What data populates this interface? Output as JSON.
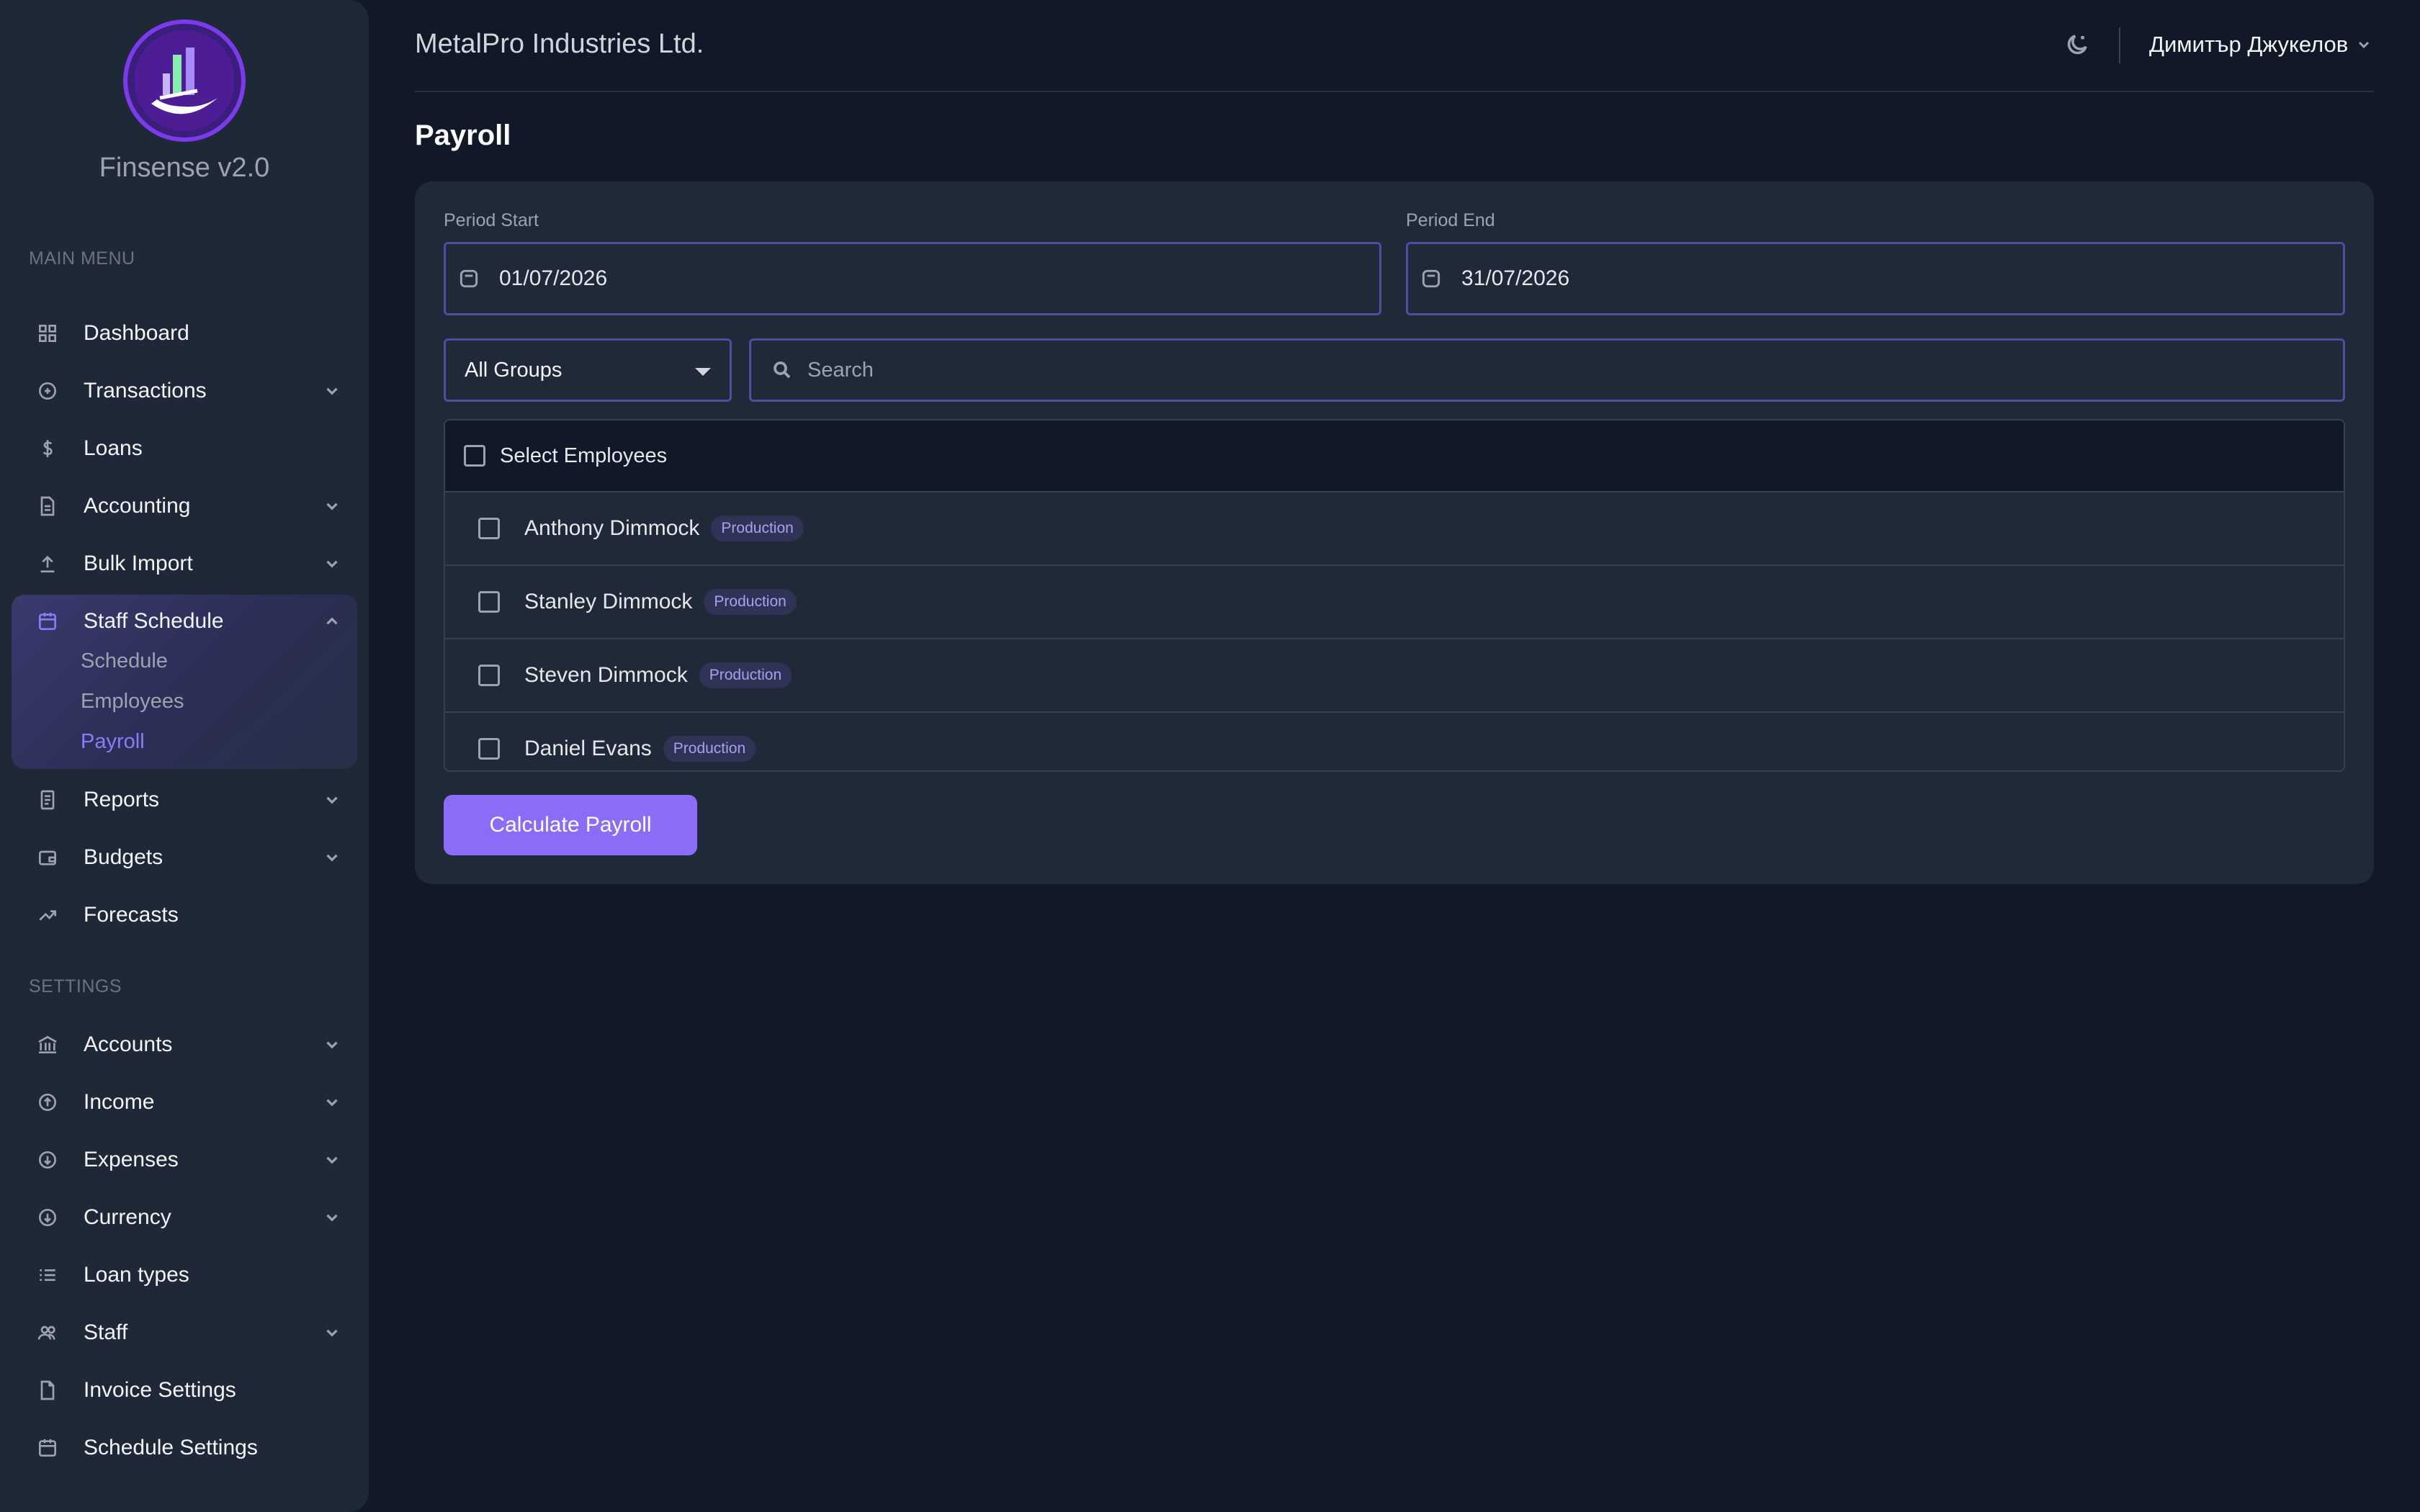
{
  "brand": {
    "name": "Finsense v2.0"
  },
  "sidebar": {
    "main_label": "MAIN MENU",
    "settings_label": "SETTINGS",
    "main_items": [
      {
        "label": "Dashboard",
        "icon": "grid-icon"
      },
      {
        "label": "Transactions",
        "icon": "plus-circle-icon"
      },
      {
        "label": "Loans",
        "icon": "dollar-icon"
      },
      {
        "label": "Accounting",
        "icon": "document-icon"
      },
      {
        "label": "Bulk Import",
        "icon": "upload-icon"
      },
      {
        "label": "Staff Schedule",
        "icon": "calendar-icon"
      },
      {
        "label": "Reports",
        "icon": "report-icon"
      },
      {
        "label": "Budgets",
        "icon": "wallet-icon"
      },
      {
        "label": "Forecasts",
        "icon": "trend-icon"
      }
    ],
    "staff_sub": [
      "Schedule",
      "Employees",
      "Payroll"
    ],
    "settings_items": [
      {
        "label": "Accounts",
        "icon": "bank-icon"
      },
      {
        "label": "Income",
        "icon": "arrow-up-circle-icon"
      },
      {
        "label": "Expenses",
        "icon": "arrow-down-circle-icon"
      },
      {
        "label": "Currency",
        "icon": "currency-icon"
      },
      {
        "label": "Loan types",
        "icon": "list-icon"
      },
      {
        "label": "Staff",
        "icon": "people-icon"
      },
      {
        "label": "Invoice Settings",
        "icon": "file-icon"
      },
      {
        "label": "Schedule Settings",
        "icon": "calendar-icon"
      }
    ]
  },
  "header": {
    "company": "MetalPro Industries Ltd.",
    "user": "Димитър Джукелов"
  },
  "page": {
    "title": "Payroll"
  },
  "form": {
    "period_start_label": "Period Start",
    "period_start_value": "01/07/2026",
    "period_end_label": "Period End",
    "period_end_value": "31/07/2026",
    "group_select": "All Groups",
    "search_placeholder": "Search",
    "select_all_label": "Select Employees",
    "employees": [
      {
        "name": "Anthony Dimmock",
        "group": "Production"
      },
      {
        "name": "Stanley Dimmock",
        "group": "Production"
      },
      {
        "name": "Steven Dimmock",
        "group": "Production"
      },
      {
        "name": "Daniel Evans",
        "group": "Production"
      }
    ],
    "submit_label": "Calculate Payroll"
  },
  "colors": {
    "background": "#111827",
    "sidebar": "#1e2837",
    "accent": "#8b6cf6",
    "card": "#1f2937"
  }
}
